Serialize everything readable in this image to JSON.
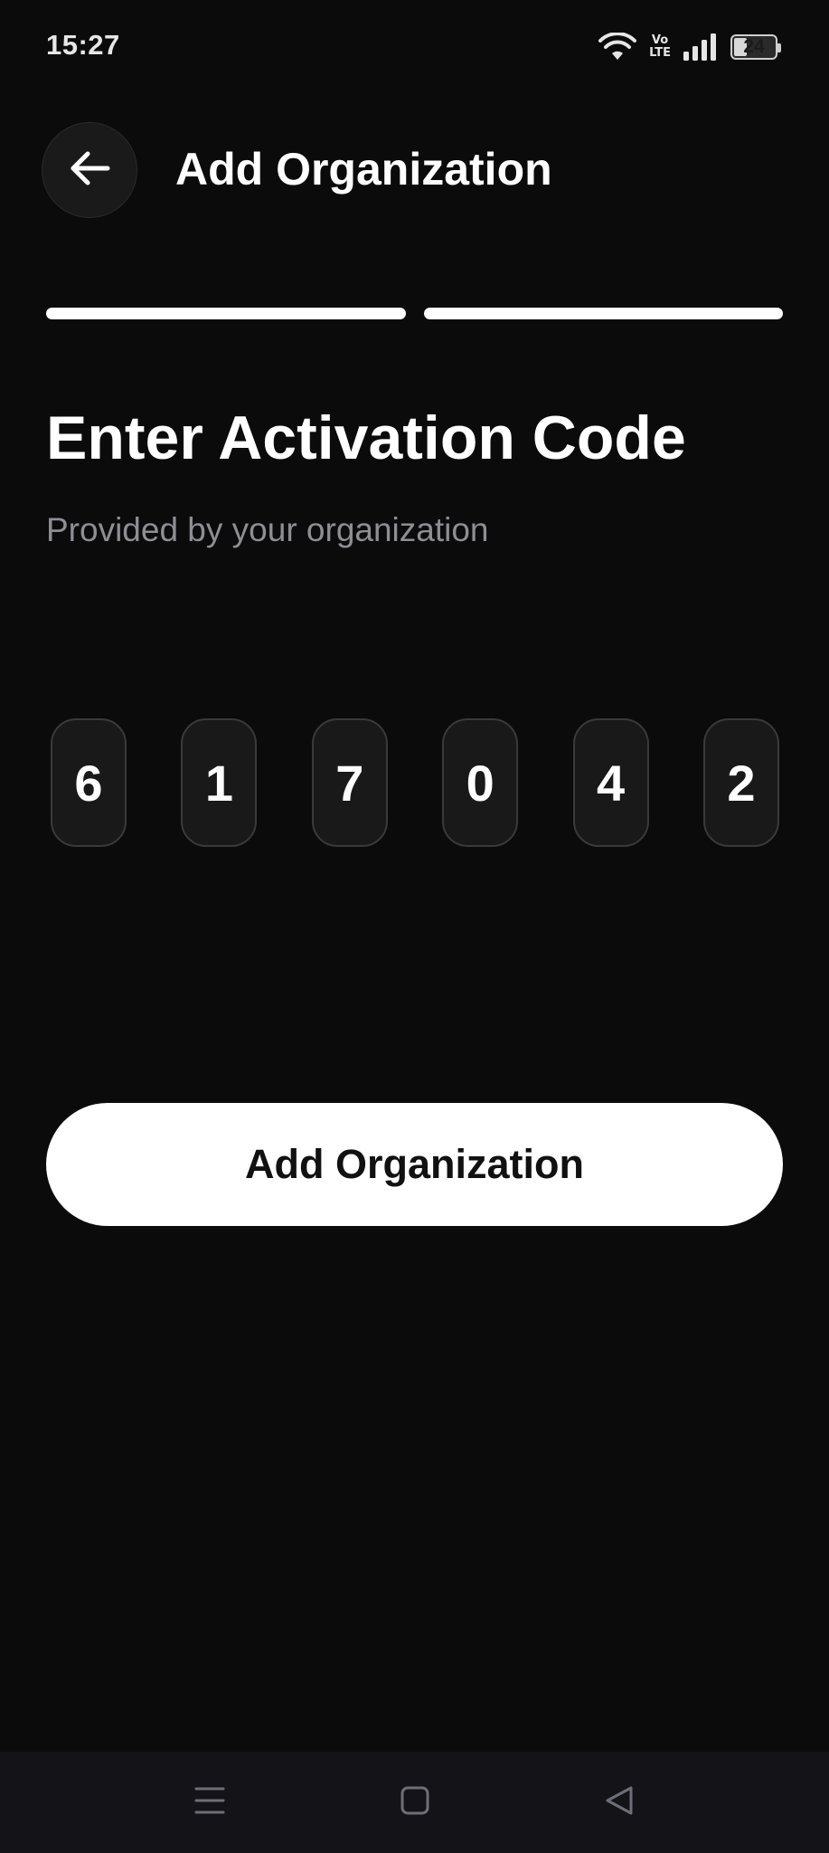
{
  "status_bar": {
    "time": "15:27",
    "network_label": "Vo\nLTE",
    "battery_level": "24",
    "icons": [
      "wifi-icon",
      "volte-icon",
      "signal-icon",
      "battery-icon"
    ]
  },
  "header": {
    "title": "Add Organization",
    "back_icon": "arrow-left-icon"
  },
  "progress": {
    "total_steps": 2,
    "completed_steps": 2
  },
  "main": {
    "heading": "Enter Activation Code",
    "subheading": "Provided by your organization",
    "code_digits": [
      "6",
      "1",
      "7",
      "0",
      "4",
      "2"
    ],
    "submit_label": "Add Organization"
  },
  "nav_bar": {
    "icons": [
      "menu-icon",
      "home-square-icon",
      "back-triangle-icon"
    ]
  },
  "colors": {
    "background": "#0b0b0c",
    "accent": "#ffffff",
    "muted_text": "#8e8e93",
    "code_box_bg": "#19191a",
    "code_box_border": "#3a3a3d",
    "nav_bar_bg": "#131318"
  }
}
